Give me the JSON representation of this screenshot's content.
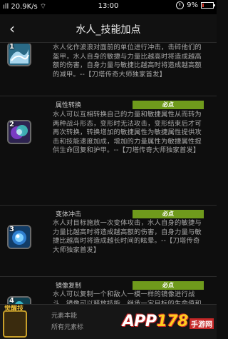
{
  "statusbar": {
    "carrier_signal": "ıll",
    "speed": "20.9K/s",
    "wifi_icon": "wifi-icon",
    "time": "13:00",
    "battery_pct": "9%"
  },
  "header": {
    "back_icon": "chevron-left-icon",
    "back_glyph": "‹",
    "title": "水人_技能加点"
  },
  "skills": [
    {
      "num": "1",
      "name": "",
      "badge": "",
      "desc": "水人化作波浪对面前的单位进行冲击，击碎他们的盔甲，水人自身的敏捷与力量比越高时将造成越高额的伤害，自身力量与敏捷比越高时将造成越高额的减甲。--【刀塔传奇大师独家首发】"
    },
    {
      "num": "2",
      "name": "属性转换",
      "badge": "必点",
      "desc": "水人可以互相转换自己的力量和敏捷属性从而转为两种战斗形态，变形时无法攻击，变形结束后才可再次转换，转换增加的敏捷属性为敏捷属性提供攻击和技能速度加成，增加的力量属性为敏捷属性提供生命回复和护甲。--【刀塔传奇大师独家首发】"
    },
    {
      "num": "3",
      "name": "变体冲击",
      "badge": "必点",
      "desc": "水人对目标施放一次变体攻击，水人自身的敏捷与力量比越高时将造成越高额的伤害，自身力量与敏捷比越高时将造成越长时间的眩晕。--【刀塔传奇大师独家首发】"
    },
    {
      "num": "4",
      "name": "镜像复制",
      "badge": "必点",
      "desc": "水人可以复制一个和敌人一模一样的镜像进行战斗，镜像可以释放技能，继承一定目标的生命值和攻击力，镜像招出时一定时间内无法被选定，水人不可以复制敌方的水人。--【刀塔传奇大师独家首发】"
    }
  ],
  "bottom": {
    "tag": "觉醒技",
    "row1": "元素本能",
    "row2": "所有元素标"
  },
  "watermark": {
    "logo_prefix": "APP",
    "logo_num": "178",
    "logo_sub": "手游网"
  }
}
